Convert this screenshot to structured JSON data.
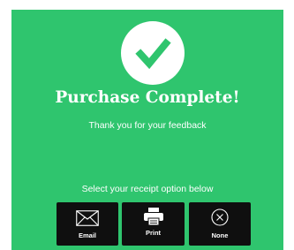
{
  "theme": {
    "background": "#2fc56e",
    "button_background": "#0f0f0f",
    "text_color": "#ffffff"
  },
  "header": {
    "icon": "checkmark-circle-icon",
    "title": "Purchase Complete!",
    "subtitle": "Thank you for your feedback"
  },
  "receipt": {
    "prompt": "Select your receipt option below",
    "options": [
      {
        "label": "Email",
        "icon": "envelope-icon"
      },
      {
        "label": "Print",
        "icon": "printer-icon"
      },
      {
        "label": "None",
        "icon": "x-circle-icon"
      }
    ]
  }
}
